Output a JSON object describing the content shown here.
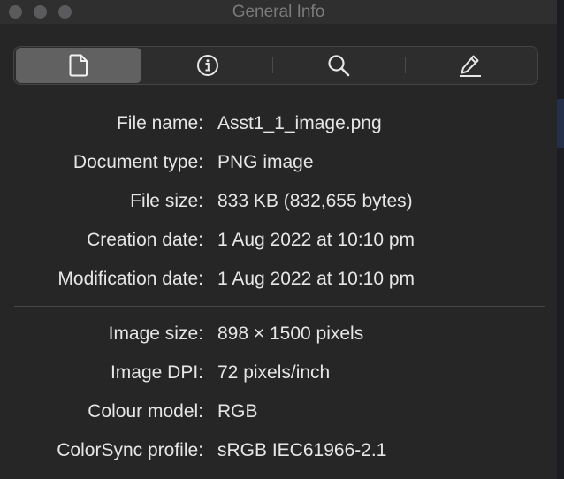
{
  "window": {
    "title": "General Info"
  },
  "toolbar": {
    "tabs": [
      {
        "icon": "document-icon",
        "selected": true
      },
      {
        "icon": "info-icon",
        "selected": false
      },
      {
        "icon": "search-icon",
        "selected": false
      },
      {
        "icon": "pencil-icon",
        "selected": false
      }
    ]
  },
  "general": {
    "file_name_label": "File name:",
    "file_name": "Asst1_1_image.png",
    "doc_type_label": "Document type:",
    "doc_type": "PNG image",
    "file_size_label": "File size:",
    "file_size": "833 KB (832,655 bytes)",
    "created_label": "Creation date:",
    "created": "1 Aug 2022 at 10:10 pm",
    "modified_label": "Modification date:",
    "modified": "1 Aug 2022 at 10:10 pm"
  },
  "image": {
    "size_label": "Image size:",
    "size": "898 × 1500 pixels",
    "dpi_label": "Image DPI:",
    "dpi": "72 pixels/inch",
    "colour_model_label": "Colour model:",
    "colour_model": "RGB",
    "profile_label": "ColorSync profile:",
    "profile": "sRGB IEC61966-2.1"
  },
  "colors": {
    "window_bg": "#262626",
    "text": "#e6e6e6",
    "title_text": "#7b7b7b",
    "selected_segment": "#616161"
  }
}
